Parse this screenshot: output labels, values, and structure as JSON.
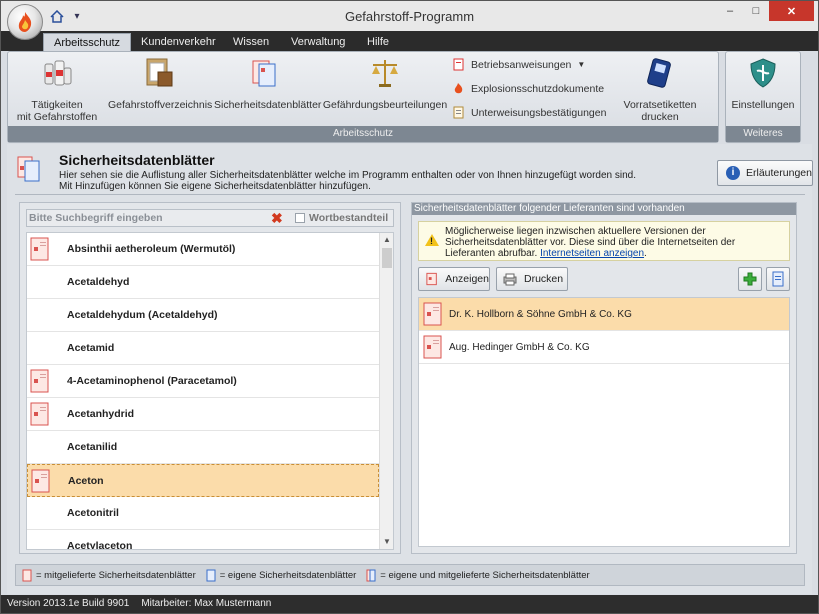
{
  "window": {
    "title": "Gefahrstoff-Programm",
    "controls": {
      "minimize": "–",
      "maximize": "□",
      "close": "✕"
    }
  },
  "tabs": [
    {
      "label": "Arbeitsschutz",
      "active": true
    },
    {
      "label": "Kundenverkehr",
      "active": false
    },
    {
      "label": "Wissen",
      "active": false
    },
    {
      "label": "Verwaltung",
      "active": false
    },
    {
      "label": "Hilfe",
      "active": false
    }
  ],
  "ribbon": {
    "group_main_label": "Arbeitsschutz",
    "group_more_label": "Weiteres",
    "buttons": [
      {
        "label": "Tätigkeiten\nmit Gefahrstoffen",
        "icon": "bottles-icon"
      },
      {
        "label": "Gefahrstoffverzeichnis",
        "icon": "clipboard-box-icon"
      },
      {
        "label": "Sicherheitsdatenblätter",
        "icon": "datasheets-icon"
      },
      {
        "label": "Gefährdungsbeurteilungen",
        "icon": "scales-icon"
      },
      {
        "label": "Vorratsetiketten drucken",
        "icon": "label-printer-icon"
      },
      {
        "label": "Einstellungen",
        "icon": "shield-settings-icon"
      }
    ],
    "small_buttons": [
      {
        "label": "Betriebsanweisungen",
        "icon": "instructions-icon",
        "has_dropdown": true
      },
      {
        "label": "Explosionsschutzdokumente",
        "icon": "flame-icon"
      },
      {
        "label": "Unterweisungsbestätigungen",
        "icon": "confirmation-icon"
      }
    ]
  },
  "page": {
    "title": "Sicherheitsdatenblätter",
    "description_line1": "Hier sehen sie die Auflistung aller Sicherheitsdatenblätter welche im Programm enthalten oder von Ihnen hinzugefügt worden sind.",
    "description_line2": "Mit Hinzufügen können Sie eigene Sicherheitsdatenblätter hinzufügen.",
    "explain_button": "Erläuterungen"
  },
  "search": {
    "placeholder": "Bitte Suchbegriff eingeben",
    "word_part_label": "Wortbestandteil",
    "word_part_checked": false
  },
  "substances": [
    {
      "name": "Absinthii aetheroleum (Wermutöl)",
      "has_sheet": true,
      "selected": false
    },
    {
      "name": "Acetaldehyd",
      "has_sheet": false,
      "selected": false
    },
    {
      "name": "Acetaldehydum (Acetaldehyd)",
      "has_sheet": false,
      "selected": false
    },
    {
      "name": "Acetamid",
      "has_sheet": false,
      "selected": false
    },
    {
      "name": "4-Acetaminophenol (Paracetamol)",
      "has_sheet": true,
      "selected": false
    },
    {
      "name": "Acetanhydrid",
      "has_sheet": true,
      "selected": false
    },
    {
      "name": "Acetanilid",
      "has_sheet": false,
      "selected": false
    },
    {
      "name": "Aceton",
      "has_sheet": true,
      "selected": true
    },
    {
      "name": "Acetonitril",
      "has_sheet": false,
      "selected": false
    },
    {
      "name": "Acetylaceton",
      "has_sheet": false,
      "selected": false
    }
  ],
  "suppliers_panel": {
    "header": "Sicherheitsdatenblätter folgender Lieferanten sind vorhanden",
    "warning_text": "Möglicherweise liegen inzwischen aktuellere Versionen der Sicherheitsdatenblätter vor. Diese sind über die Internetseiten der Lieferanten abrufbar.",
    "warning_link": "Internetseiten anzeigen",
    "warning_end": ".",
    "show_button": "Anzeigen",
    "print_button": "Drucken",
    "suppliers": [
      {
        "name": "Dr. K. Hollborn & Söhne GmbH & Co. KG",
        "selected": true
      },
      {
        "name": "Aug. Hedinger GmbH & Co. KG",
        "selected": false
      }
    ]
  },
  "legend": {
    "supplied": "= mitgelieferte Sicherheitsdatenblätter",
    "own": "= eigene Sicherheitsdatenblätter",
    "both": "= eigene und mitgelieferte Sicherheitsdatenblätter"
  },
  "status": {
    "version": "Version 2013.1e Build 9901",
    "employee": "Mitarbeiter: Max Mustermann"
  },
  "colors": {
    "selection": "#fbdcaa",
    "tabstrip": "#2b2b2b",
    "close": "#c7362b",
    "sheet_red": "#d9534f",
    "sheet_blue": "#3a6ec9"
  }
}
